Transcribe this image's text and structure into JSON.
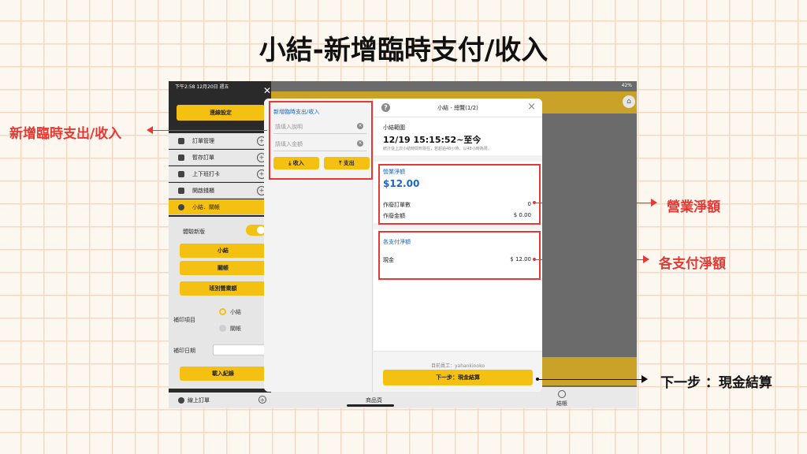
{
  "page": {
    "title": "小結-新增臨時支付/收入"
  },
  "status_bar": {
    "left": "下午2:58  12月20日 週五",
    "right": "42%"
  },
  "sidebar": {
    "close": "✕",
    "connection_button": "連線設定",
    "items": [
      {
        "label": "訂單管理"
      },
      {
        "label": "暫存訂單"
      },
      {
        "label": "上下班打卡"
      },
      {
        "label": "開啟錢櫃"
      },
      {
        "label": "小結．關帳"
      }
    ],
    "experience_label": "體驗新版",
    "buttons": [
      "小結",
      "關帳",
      "班別營業額"
    ],
    "reprint_label": "補印項目",
    "reprint_options": [
      "小結",
      "關帳"
    ],
    "reprint_date_label": "補印日期",
    "load_button": "載入紀錄",
    "online_order": "線上訂單"
  },
  "main": {
    "bottom_left": "商品頁",
    "bottom_right": "結帳"
  },
  "modal": {
    "left": {
      "title": "新增臨時支出/收入",
      "desc_placeholder": "請填入說明",
      "amount_placeholder": "請填入金額",
      "income_button": "收入",
      "expense_button": "支出"
    },
    "right": {
      "header_title": "小結 - 總覽(1/2)",
      "range_label": "小結範圍",
      "range_value": "12/19 15:15:52~至今",
      "range_note": "統計從上次小結時間到現在，若超過48小時，以48小時為限。",
      "sales_title": "營業淨額",
      "sales_value": "$12.00",
      "void_count_label": "作廢訂單數",
      "void_count_value": "0",
      "void_amount_label": "作廢金額",
      "void_amount_value": "$ 0.00",
      "payment_title": "各支付淨額",
      "cash_label": "現金",
      "cash_value": "$ 12.00",
      "staff": "目前員工：yahankinoko",
      "next_button": "下一步：現金結算"
    }
  },
  "callouts": {
    "temp_income": "新增臨時支出/收入",
    "net_sales": "營業淨額",
    "payment_net": "各支付淨額",
    "next_step": "下一步 ：現金結算"
  },
  "colors": {
    "accent": "#f4c112",
    "highlight": "#e53935",
    "link_blue": "#1a66c8"
  }
}
